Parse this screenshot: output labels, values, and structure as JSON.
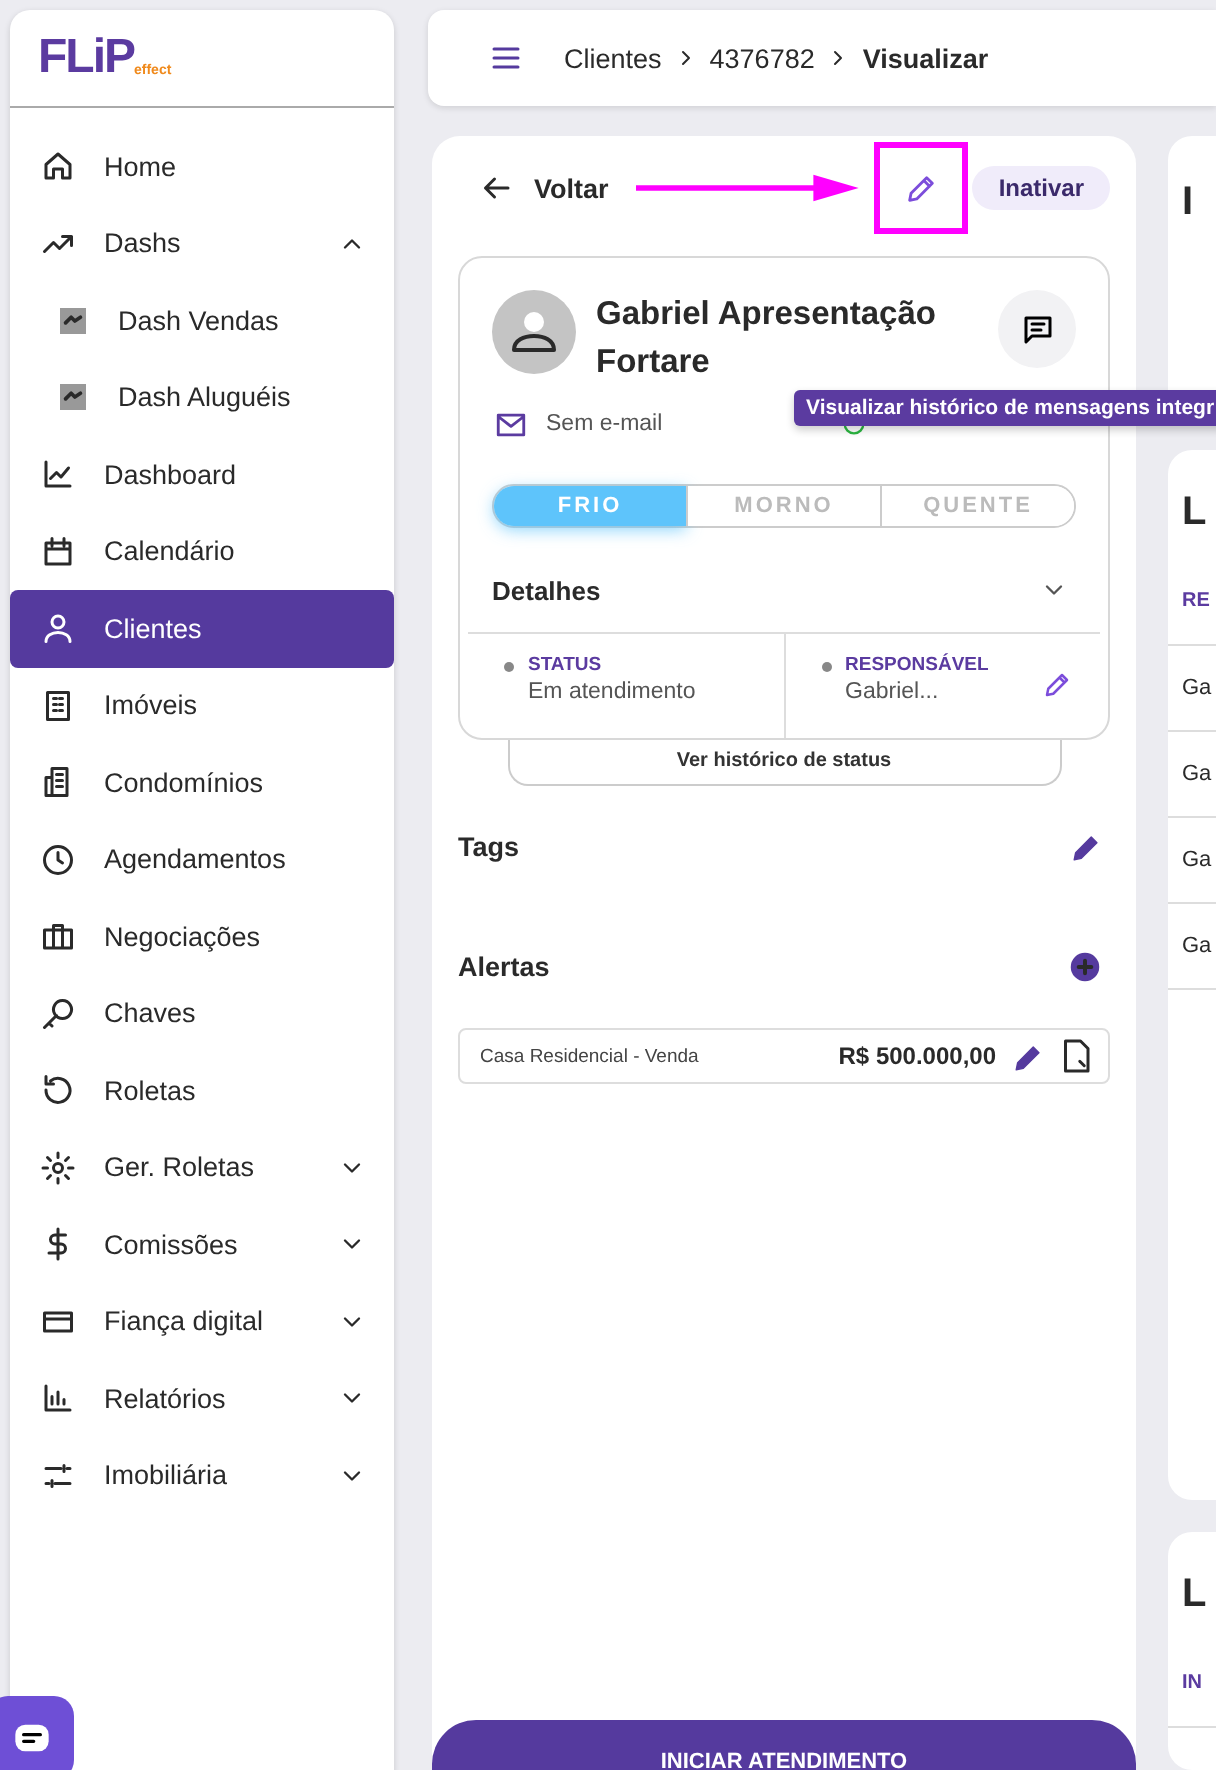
{
  "logo": {
    "name": "FLiP",
    "tagline": "effect"
  },
  "sidebar": {
    "items": [
      {
        "label": "Home",
        "selected": false
      },
      {
        "label": "Dashs",
        "selected": false,
        "expanded": true,
        "children": [
          {
            "label": "Dash Vendas",
            "selected": false
          },
          {
            "label": "Dash Aluguéis",
            "selected": false
          }
        ]
      },
      {
        "label": "Dashboard",
        "selected": false
      },
      {
        "label": "Calendário",
        "selected": false
      },
      {
        "label": "Clientes",
        "selected": true
      },
      {
        "label": "Imóveis",
        "selected": false
      },
      {
        "label": "Condomínios",
        "selected": false
      },
      {
        "label": "Agendamentos",
        "selected": false
      },
      {
        "label": "Negociações",
        "selected": false
      },
      {
        "label": "Chaves",
        "selected": false
      },
      {
        "label": "Roletas",
        "selected": false
      },
      {
        "label": "Ger. Roletas",
        "selected": false,
        "expanded": false
      },
      {
        "label": "Comissões",
        "selected": false,
        "expanded": false
      },
      {
        "label": "Fiança digital",
        "selected": false,
        "expanded": false
      },
      {
        "label": "Relatórios",
        "selected": false,
        "expanded": false
      },
      {
        "label": "Imobiliária",
        "selected": false,
        "expanded": false
      }
    ]
  },
  "breadcrumbs": [
    "Clientes",
    "4376782",
    "Visualizar"
  ],
  "toolbar": {
    "back": "Voltar",
    "inactivate": "Inativar"
  },
  "client": {
    "name": "Gabriel Apresentação Fortare",
    "email": "Sem e-mail",
    "temperature": [
      {
        "label": "FRIO",
        "selected": true
      },
      {
        "label": "MORNO",
        "selected": false
      },
      {
        "label": "QUENTE",
        "selected": false
      }
    ],
    "details_title": "Detalhes",
    "details_expanded": false,
    "fields": [
      {
        "label": "STATUS",
        "value": "Em atendimento"
      },
      {
        "label": "RESPONSÁVEL",
        "value": "Gabriel...",
        "editable": true
      }
    ],
    "history_button": "Ver histórico de status"
  },
  "tooltip": "Visualizar histórico de mensagens integr",
  "tags": {
    "title": "Tags"
  },
  "alerts": {
    "title": "Alertas",
    "items": [
      {
        "name": "Casa Residencial - Venda",
        "price": "R$ 500.000,00"
      }
    ]
  },
  "start_button": "INICIAR ATENDIMENTO",
  "right_cards": [
    {
      "title": "I"
    },
    {
      "title": "L",
      "header": "RE",
      "rows": [
        "Ga",
        "Ga",
        "Ga",
        "Ga"
      ]
    },
    {
      "title": "L",
      "header": "IN"
    }
  ]
}
